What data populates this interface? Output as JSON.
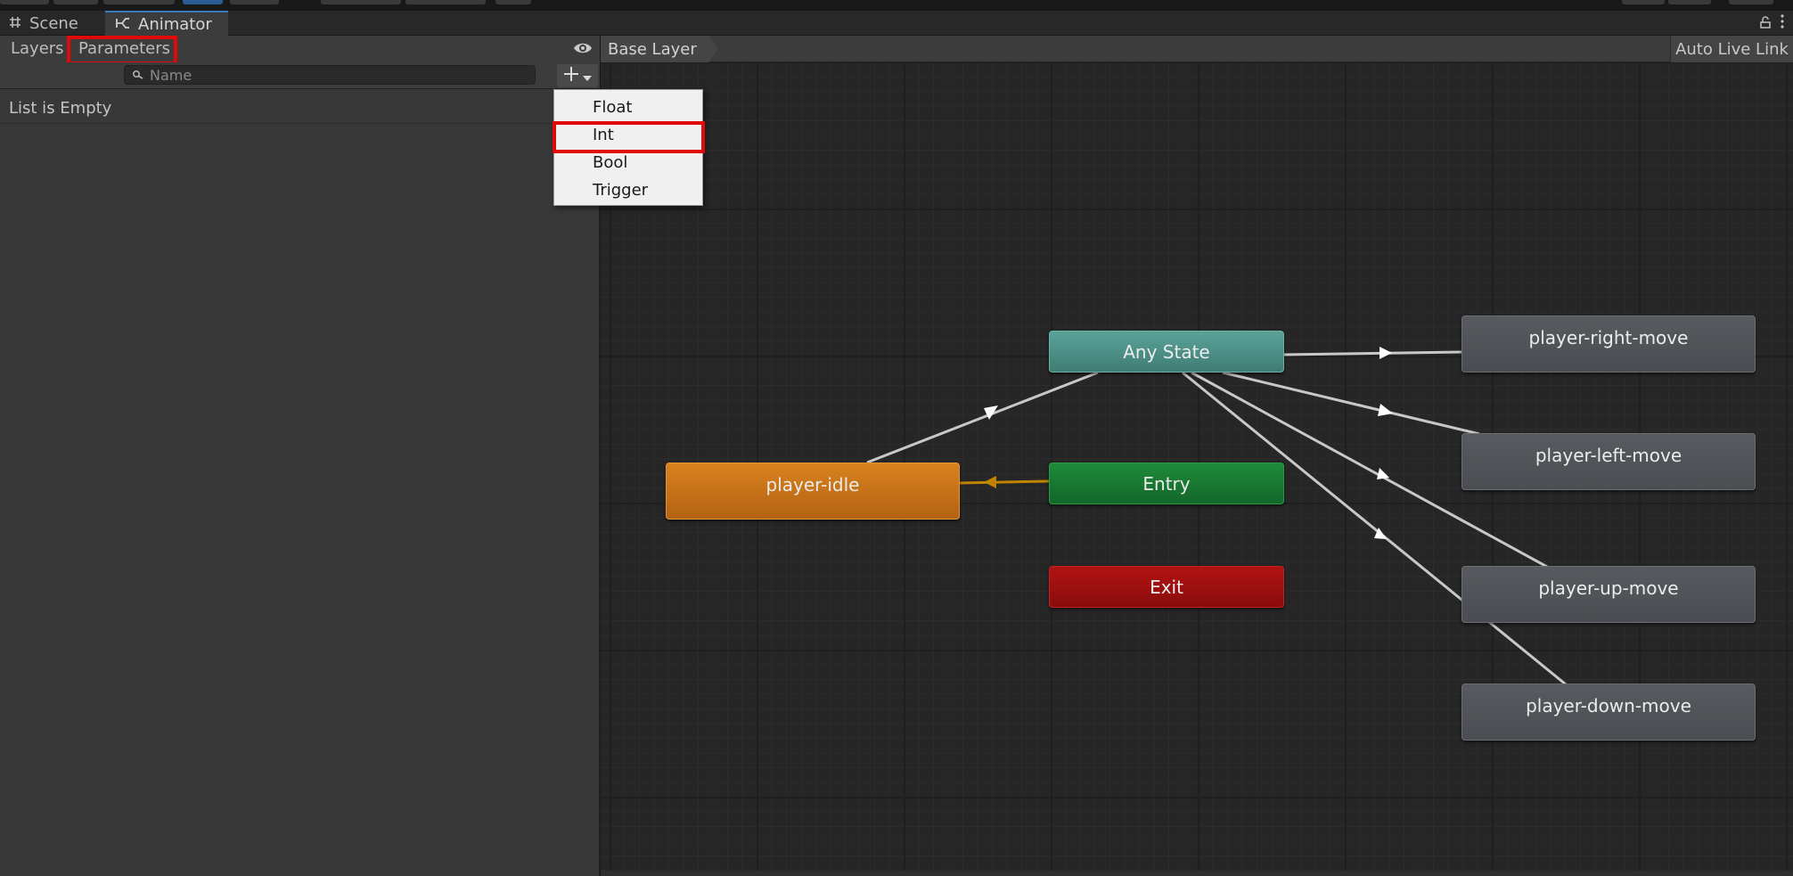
{
  "tabs": {
    "scene_label": "Scene",
    "animator_label": "Animator"
  },
  "left_panel": {
    "layers_label": "Layers",
    "parameters_label": "Parameters",
    "search_placeholder": "Name",
    "empty_text": "List is Empty"
  },
  "dropdown": {
    "items": [
      "Float",
      "Int",
      "Bool",
      "Trigger"
    ],
    "highlighted": "Int"
  },
  "graph": {
    "breadcrumb": "Base Layer",
    "auto_live_link_label": "Auto Live Link",
    "nodes": {
      "any_state": "Any State",
      "entry": "Entry",
      "exit": "Exit",
      "idle": "player-idle",
      "right": "player-right-move",
      "left": "player-left-move",
      "up": "player-up-move",
      "down": "player-down-move"
    }
  },
  "colors": {
    "highlight_box": "#e00a0a",
    "any_state": "#4f9189",
    "entry": "#197a32",
    "exit": "#9e1010",
    "default_state": "#d07a1c",
    "state": "#525559",
    "default_transition": "#c08400",
    "transition": "#c8c8c8",
    "accent_tab": "#3a79bb"
  },
  "icons": [
    "grid-icon",
    "animator-icon",
    "lock-icon",
    "kebab-menu-icon",
    "eye-icon",
    "search-icon",
    "plus-icon",
    "dropdown-arrow-icon"
  ]
}
